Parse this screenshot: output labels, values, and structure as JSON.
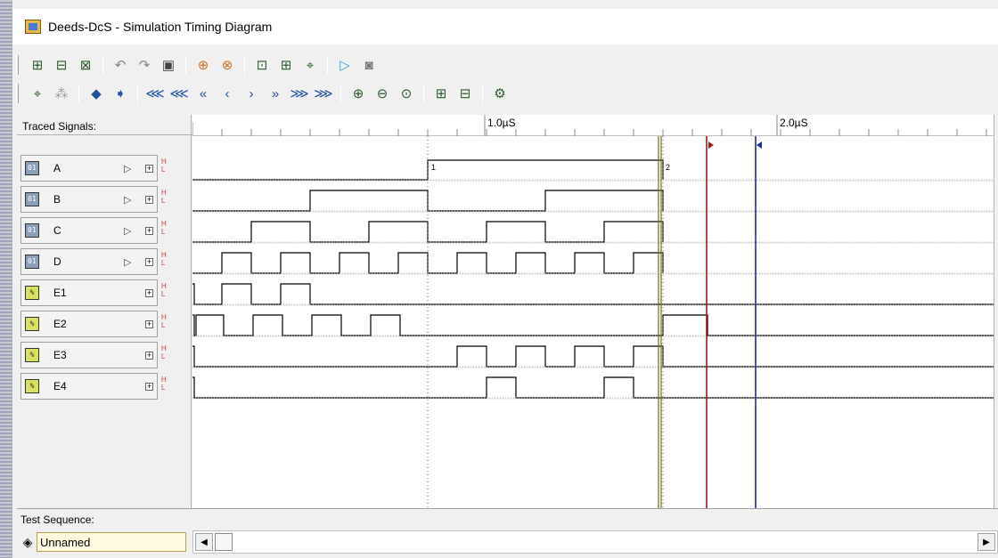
{
  "window": {
    "title": "Deeds-DcS  -  Simulation Timing Diagram"
  },
  "toolbar1": {
    "icons": [
      "open-trace-icon",
      "save-trace-icon",
      "clear-trace-icon",
      "undo-icon",
      "redo-icon",
      "clipboard-icon",
      "add-signal-icon",
      "remove-signal-icon",
      "zoom-fit-icon",
      "zoom-region-icon",
      "probe-icon",
      "run-icon",
      "stop-icon"
    ]
  },
  "toolbar2": {
    "icons": [
      "probe-select-icon",
      "probe-pattern-icon",
      "arrow-left-icon",
      "arrow-right-icon",
      "first-icon",
      "fast-back-icon",
      "back-icon",
      "step-back-icon",
      "step-forward-icon",
      "forward-icon",
      "fast-forward-icon",
      "last-icon",
      "zoom-in-icon",
      "zoom-out-icon",
      "zoom-fit-icon",
      "signal-up-icon",
      "signal-down-icon",
      "settings-icon"
    ]
  },
  "left": {
    "traced_label": "Traced Signals:",
    "signals": [
      {
        "name": "A",
        "kind": "input"
      },
      {
        "name": "B",
        "kind": "input"
      },
      {
        "name": "C",
        "kind": "input"
      },
      {
        "name": "D",
        "kind": "input"
      },
      {
        "name": "E1",
        "kind": "output"
      },
      {
        "name": "E2",
        "kind": "output"
      },
      {
        "name": "E3",
        "kind": "output"
      },
      {
        "name": "E4",
        "kind": "output"
      }
    ],
    "hl_high": "H",
    "hl_low": "L"
  },
  "ruler": {
    "labels": [
      "1.0µS",
      "2.0µS"
    ]
  },
  "markers": {
    "m1": "1",
    "m2": "2"
  },
  "cursor_colors": {
    "marker": "#a01818",
    "cursor": "#1a2ea0",
    "sim_end": "#6e6e20"
  },
  "bottom": {
    "test_sequence_label": "Test Sequence:",
    "sequence_name": "Unnamed"
  }
}
